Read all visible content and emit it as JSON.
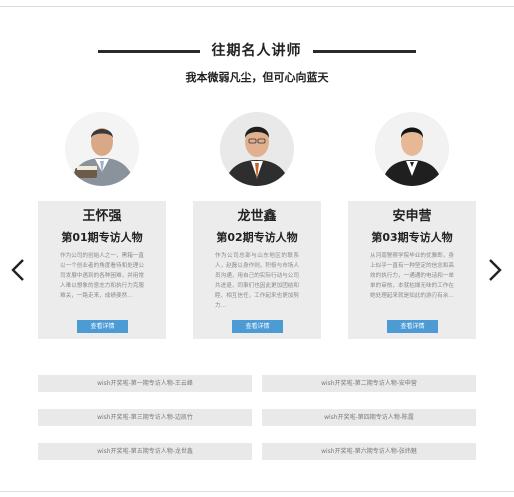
{
  "section": {
    "title": "往期名人讲师",
    "subtitle": "我本微弱凡尘，但可心向蓝天"
  },
  "carousel": {
    "prev_icon": "chevron-left-icon",
    "next_icon": "chevron-right-icon",
    "cards": [
      {
        "name": "王怀强",
        "episode": "第01期专访人物",
        "description": "作为公司的创始人之一，黑箱一直以一个创业者的角度看待和处理公司发展中遇到的各种困难，并用常人难以想象的意志力和执行力克服难关，一路走来，成绩斐然...",
        "button": "查看详情"
      },
      {
        "name": "龙世鑫",
        "episode": "第02期专访人物",
        "description": "作为公司总部与山东地区的联系人，赵磊以身作则，积极与市场人员沟通，用自己的实际行动与公司共进退，同事们也因此更加团结和睦、相互信任，工作起来也更加努力...",
        "button": "查看详情"
      },
      {
        "name": "安申营",
        "episode": "第03期专访人物",
        "description": "从河南警察学院毕业的优雅郎，身上似乎一直有一种坚定的信念和高效的执行力，一通通的电话和一单单的审核，本就枯燥无味的工作在她处理起来就是如此的游刃有余...",
        "button": "查看详情"
      }
    ]
  },
  "links": [
    "wish开奖啦-第一期专访人物-王云峰",
    "wish开奖啦-第二期专访人物-安申营",
    "wish开奖啦-第三期专访人物-边凯竹",
    "wish开奖啦-第四期专访人物-陈露",
    "wish开奖啦-第五期专访人物-龙世鑫",
    "wish开奖啦-第六期专访人物-张纬魅"
  ],
  "colors": {
    "accent": "#4c9bd4",
    "card_bg": "#ececec",
    "link_bg": "#e9e9e9"
  }
}
